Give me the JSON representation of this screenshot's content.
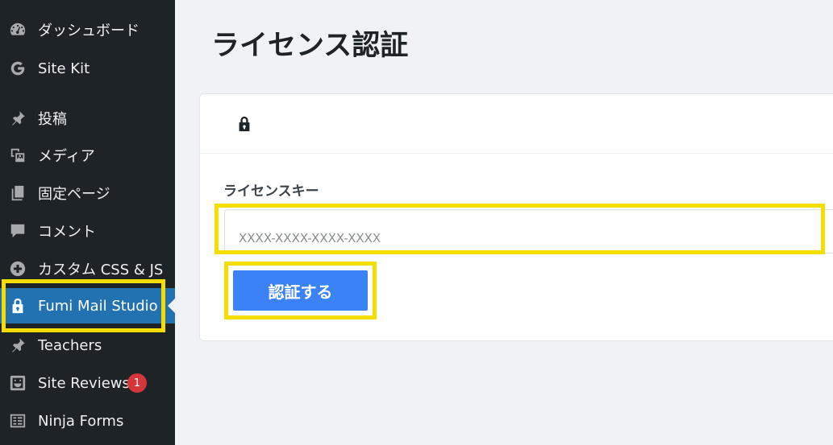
{
  "sidebar": {
    "items": [
      {
        "label": "ダッシュボード",
        "icon": "dashboard-icon"
      },
      {
        "label": "Site Kit",
        "icon": "google-g-icon"
      },
      {
        "label": "投稿",
        "icon": "pin-icon"
      },
      {
        "label": "メディア",
        "icon": "media-icon"
      },
      {
        "label": "固定ページ",
        "icon": "pages-icon"
      },
      {
        "label": "コメント",
        "icon": "comment-icon"
      },
      {
        "label": "カスタム CSS & JS",
        "icon": "plus-circle-icon"
      },
      {
        "label": "Fumi Mail Studio",
        "icon": "lock-icon",
        "active": true
      },
      {
        "label": "Teachers",
        "icon": "pin-icon"
      },
      {
        "label": "Site Reviews",
        "icon": "reviews-icon",
        "badge": "1"
      },
      {
        "label": "Ninja Forms",
        "icon": "forms-icon"
      }
    ]
  },
  "main": {
    "title": "ライセンス認証",
    "card": {
      "header_icon": "lock-icon",
      "field_label": "ライセンスキー",
      "input_placeholder": "XXXX-XXXX-XXXX-XXXX",
      "input_value": "",
      "submit_label": "認証する"
    }
  },
  "colors": {
    "sidebar_bg": "#1d2327",
    "active_bg": "#2271b1",
    "button_bg": "#3b82f6",
    "highlight": "#f5dd00",
    "badge": "#d63638"
  }
}
